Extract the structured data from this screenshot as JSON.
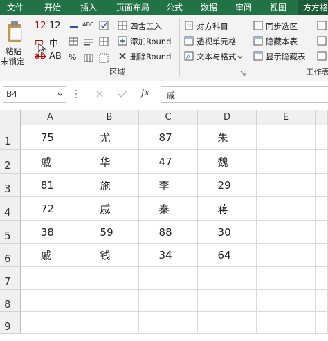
{
  "menu": [
    "文件",
    "开始",
    "插入",
    "页面布局",
    "公式",
    "数据",
    "审阅",
    "视图",
    "方方格子"
  ],
  "ribbon": {
    "paste_label_1": "粘贴",
    "paste_label_2": "未锁定",
    "glyph_12a": "12",
    "glyph_12b": "12",
    "glyph_zhong_a": "中",
    "glyph_zhong_b": "中",
    "glyph_ab_a": "ab",
    "glyph_ab_b": "AB",
    "glyph_abc": "ABC",
    "round_label": "四舍五入",
    "add_round_label": "添加Round",
    "del_round_label": "删除Round",
    "align_label": "对方科目",
    "pivot_label": "透视单元格",
    "text_format_label": "文本与格式",
    "sync_select_label": "同步选区",
    "hide_table_label": "隐藏本表",
    "show_hidden_label": "显示隐藏表",
    "group_region_label": "区域",
    "group_worksheet_label": "工作表"
  },
  "formula_bar": {
    "cell_ref": "B4",
    "fx_label": "fx",
    "formula_value": "戚"
  },
  "sheet": {
    "columns": [
      "A",
      "B",
      "C",
      "D",
      "E"
    ],
    "rows": [
      "1",
      "2",
      "3",
      "4",
      "5",
      "6",
      "7",
      "8",
      "9"
    ],
    "cells": [
      [
        "75",
        "尤",
        "87",
        "朱",
        ""
      ],
      [
        "戚",
        "华",
        "47",
        "魏",
        ""
      ],
      [
        "81",
        "施",
        "李",
        "29",
        ""
      ],
      [
        "72",
        "戚",
        "秦",
        "蒋",
        ""
      ],
      [
        "38",
        "59",
        "88",
        "30",
        ""
      ],
      [
        "戚",
        "钱",
        "34",
        "64",
        ""
      ],
      [
        "",
        "",
        "",
        "",
        ""
      ],
      [
        "",
        "",
        "",
        "",
        ""
      ],
      [
        "",
        "",
        "",
        "",
        ""
      ]
    ]
  },
  "colors": {
    "accent": "#217346",
    "header_bg": "#f0f0f0"
  }
}
